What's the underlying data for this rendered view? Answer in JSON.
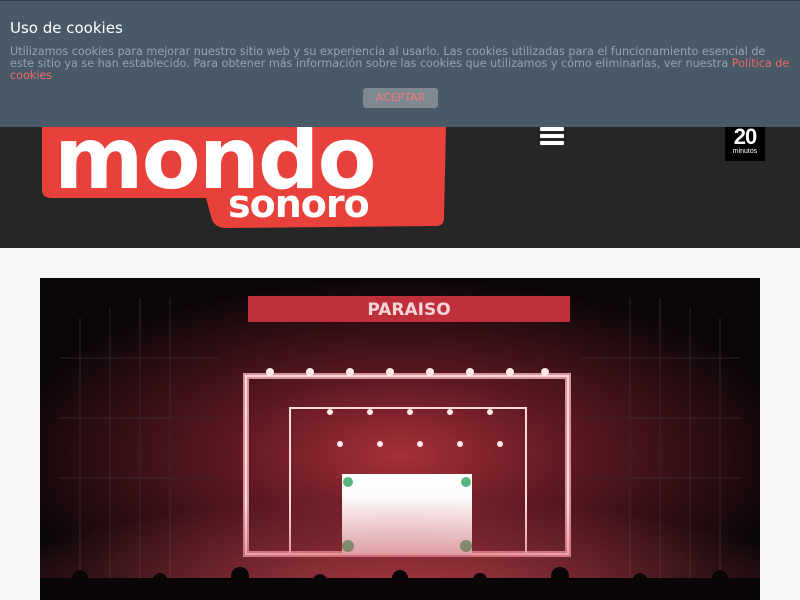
{
  "cookie_banner": {
    "title": "Uso de cookies",
    "text": "Utilizamos cookies para mejorar nuestro sitio web y su experiencia al usarlo. Las cookies utilizadas para el funcionamiento esencial de este sitio ya se han establecido. Para obtener más información sobre las cookies que utilizamos y cómo eliminarlas, ver nuestra ",
    "link_label": "Política de cookies",
    "accept_label": "ACEPTAR"
  },
  "header": {
    "logo_text_top": "mondo",
    "logo_text_bottom": "sonoro",
    "menu_icon": "hamburger-menu-icon",
    "partner_logo_number": "20",
    "partner_logo_word": "minutos"
  },
  "hero": {
    "stage_sign": "PARAISO"
  },
  "colors": {
    "header_bg": "#262626",
    "banner_bg": "#485967",
    "brand_red": "#e8403a",
    "link_color": "#ef6b6b",
    "page_bg": "#f7f7f5"
  }
}
